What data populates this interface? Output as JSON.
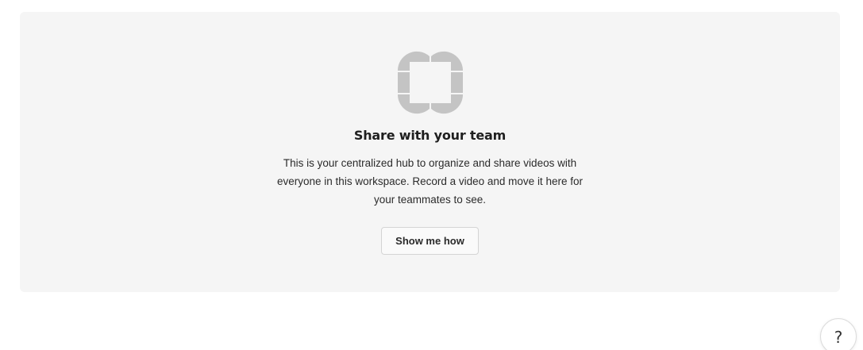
{
  "empty_state": {
    "icon": "team-hub-icon",
    "icon_color": "#c4c4c4",
    "title": "Share with your team",
    "description": "This is your centralized hub to organize and share videos with everyone in this workspace. Record a video and move it here for your teammates to see.",
    "button_label": "Show me how"
  },
  "help": {
    "label": "?",
    "icon": "help-icon"
  },
  "colors": {
    "card_background": "#f5f5f5",
    "text": "#1f1f1f"
  }
}
